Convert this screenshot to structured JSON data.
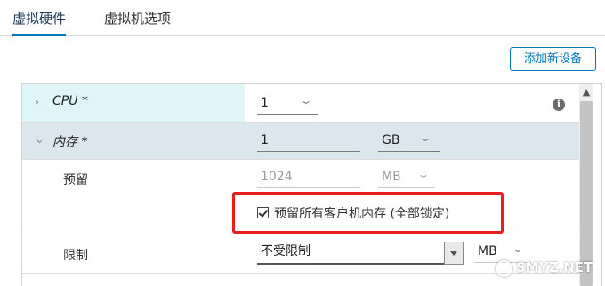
{
  "tabs": [
    {
      "label": "虚拟硬件",
      "active": true
    },
    {
      "label": "虚拟机选项",
      "active": false
    }
  ],
  "toolbar": {
    "add_device_label": "添加新设备"
  },
  "rows": {
    "cpu": {
      "label": "CPU *",
      "value": "1",
      "expanded": false
    },
    "memory": {
      "label": "内存 *",
      "value": "1",
      "unit": "GB",
      "expanded": true
    },
    "reservation": {
      "label": "预留",
      "value": "1024",
      "unit": "MB"
    },
    "reserve_all": {
      "label": "预留所有客户机内存 (全部锁定)",
      "checked": true
    },
    "limit": {
      "label": "限制",
      "value": "不受限制",
      "unit": "MB"
    }
  },
  "icons": {
    "info": "i",
    "collapsed": "›",
    "expanded": "⌄",
    "chevron": "⌄",
    "scroll_up": "▲"
  },
  "watermark": {
    "text": "SMYZ.NET"
  },
  "colors": {
    "accent": "#0079b8",
    "highlight": "#e8201c",
    "cpu_label_bg": "#dff6f8",
    "memory_row_bg": "#dbe6ed"
  }
}
